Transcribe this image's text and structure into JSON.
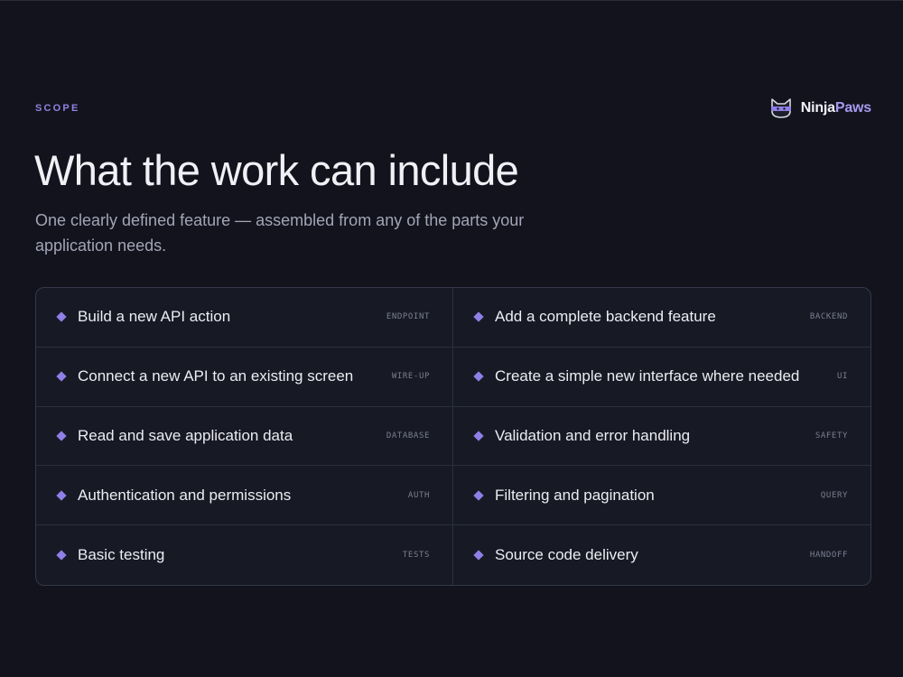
{
  "eyebrow": "SCOPE",
  "brand": {
    "name_primary": "Ninja",
    "name_accent": "Paws",
    "icon": "ninja-cat-icon",
    "accent_color": "#a79af0"
  },
  "title": "What the work can include",
  "subtitle": "One clearly defined feature — assembled from any of the parts your application needs.",
  "items": [
    {
      "label": "Build a new API action",
      "tag": "ENDPOINT"
    },
    {
      "label": "Add a complete backend feature",
      "tag": "BACKEND"
    },
    {
      "label": "Connect a new API to an existing screen",
      "tag": "WIRE-UP"
    },
    {
      "label": "Create a simple new interface where needed",
      "tag": "UI"
    },
    {
      "label": "Read and save application data",
      "tag": "DATABASE"
    },
    {
      "label": "Validation and error handling",
      "tag": "SAFETY"
    },
    {
      "label": "Authentication and permissions",
      "tag": "AUTH"
    },
    {
      "label": "Filtering and pagination",
      "tag": "QUERY"
    },
    {
      "label": "Basic testing",
      "tag": "TESTS"
    },
    {
      "label": "Source code delivery",
      "tag": "HANDOFF"
    }
  ],
  "colors": {
    "background": "#12131d",
    "accent": "#8f7fe6",
    "panel": "#171924"
  }
}
